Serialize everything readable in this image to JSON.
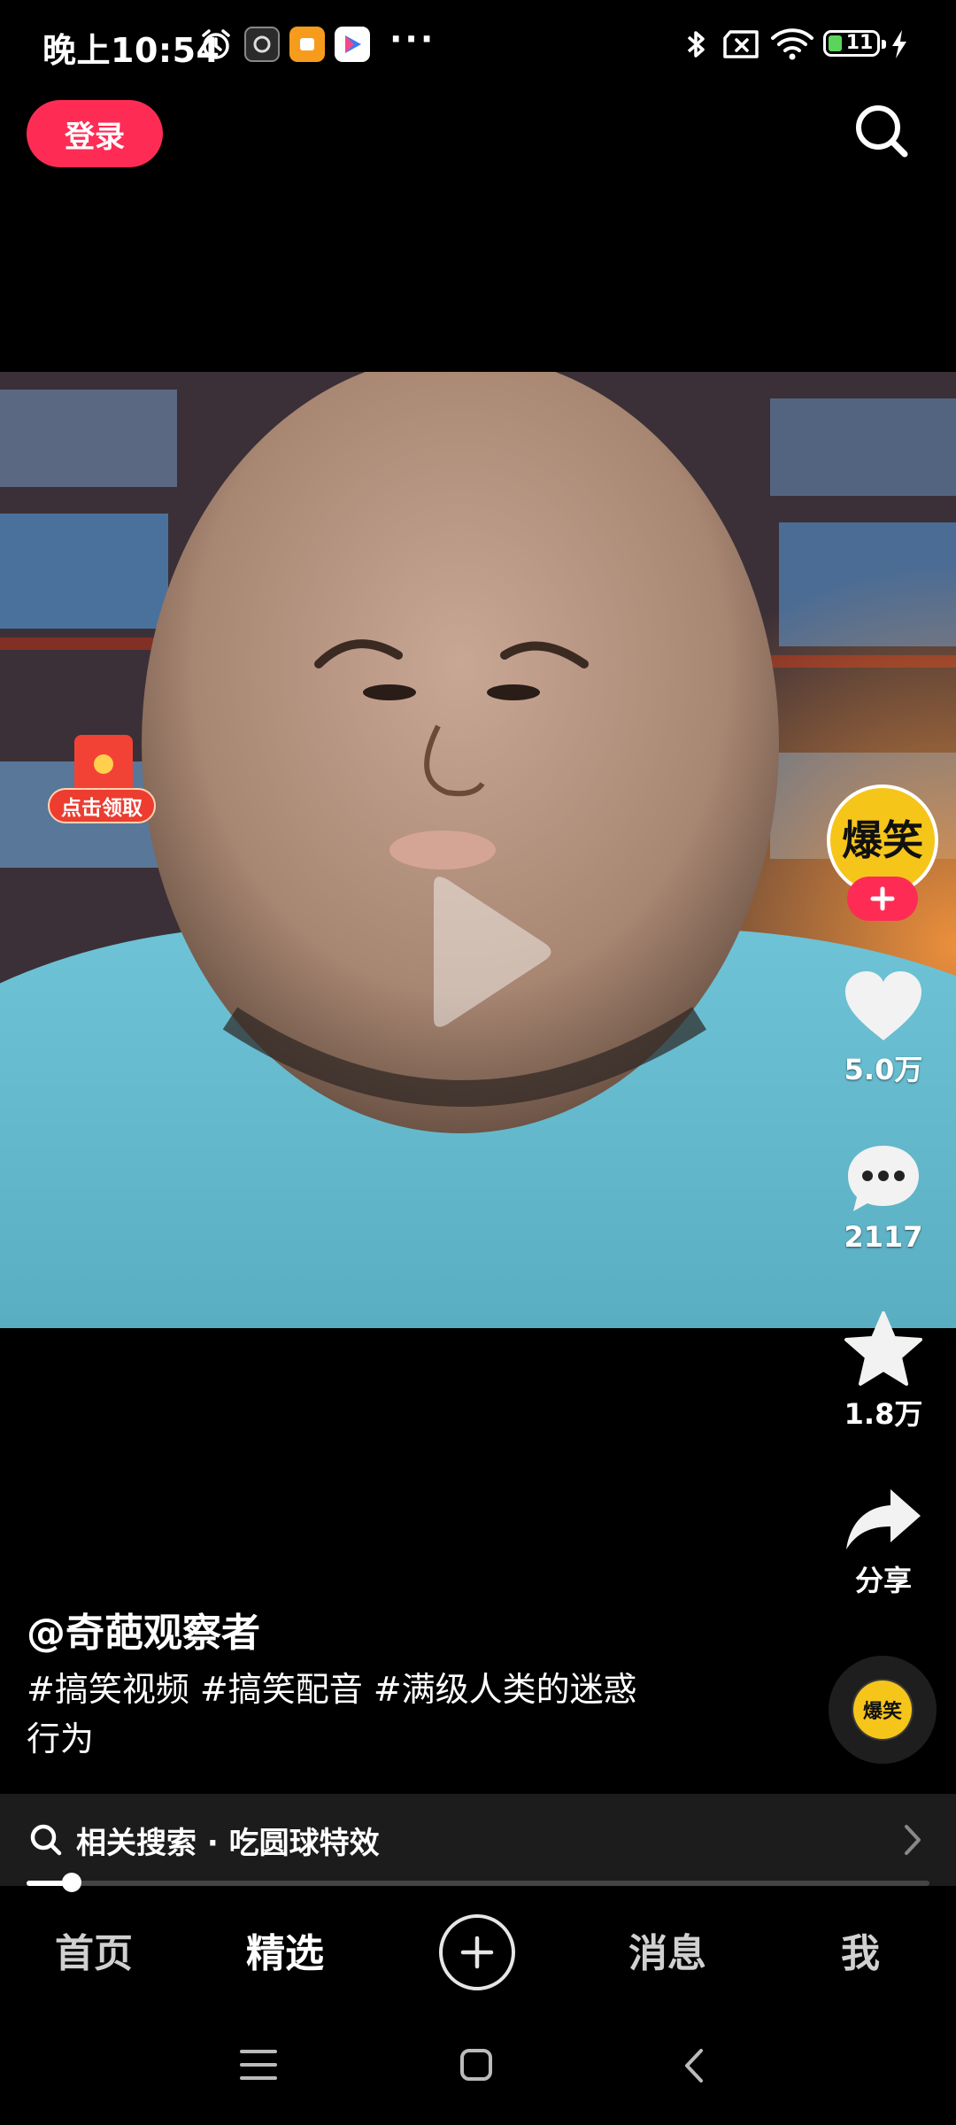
{
  "status_bar": {
    "time": "晚上10:54",
    "more": "···",
    "battery_level": "11",
    "icons": [
      "alarm-icon",
      "app-icon-dark",
      "app-icon-orange",
      "app-icon-play",
      "bluetooth-icon",
      "sim-off-icon",
      "wifi-icon",
      "battery-icon",
      "charging-icon"
    ]
  },
  "top_bar": {
    "login_label": "登录",
    "search_icon": "search-icon"
  },
  "video": {
    "red_packet_label": "点击领取",
    "play_icon": "play-icon"
  },
  "sidebar": {
    "avatar_text": "爆笑",
    "likes": "5.0万",
    "comments": "2117",
    "favorites": "1.8万",
    "share_label": "分享",
    "music_disc_text": "爆笑"
  },
  "caption": {
    "author": "@奇葩观察者",
    "description_line1": "#搞笑视频 #搞笑配音 #满级人类的迷惑",
    "description_line2": "行为"
  },
  "related_search": {
    "label": "相关搜索 · 吃圆球特效"
  },
  "progress": {
    "fraction": 0.05
  },
  "bottom_nav": {
    "items": [
      {
        "label": "首页",
        "active": false
      },
      {
        "label": "精选",
        "active": true
      },
      {
        "label": "消息",
        "active": false
      },
      {
        "label": "我",
        "active": false
      }
    ]
  },
  "colors": {
    "accent": "#fe2c55",
    "background": "#000000",
    "avatar_bg": "#f6c51a"
  }
}
